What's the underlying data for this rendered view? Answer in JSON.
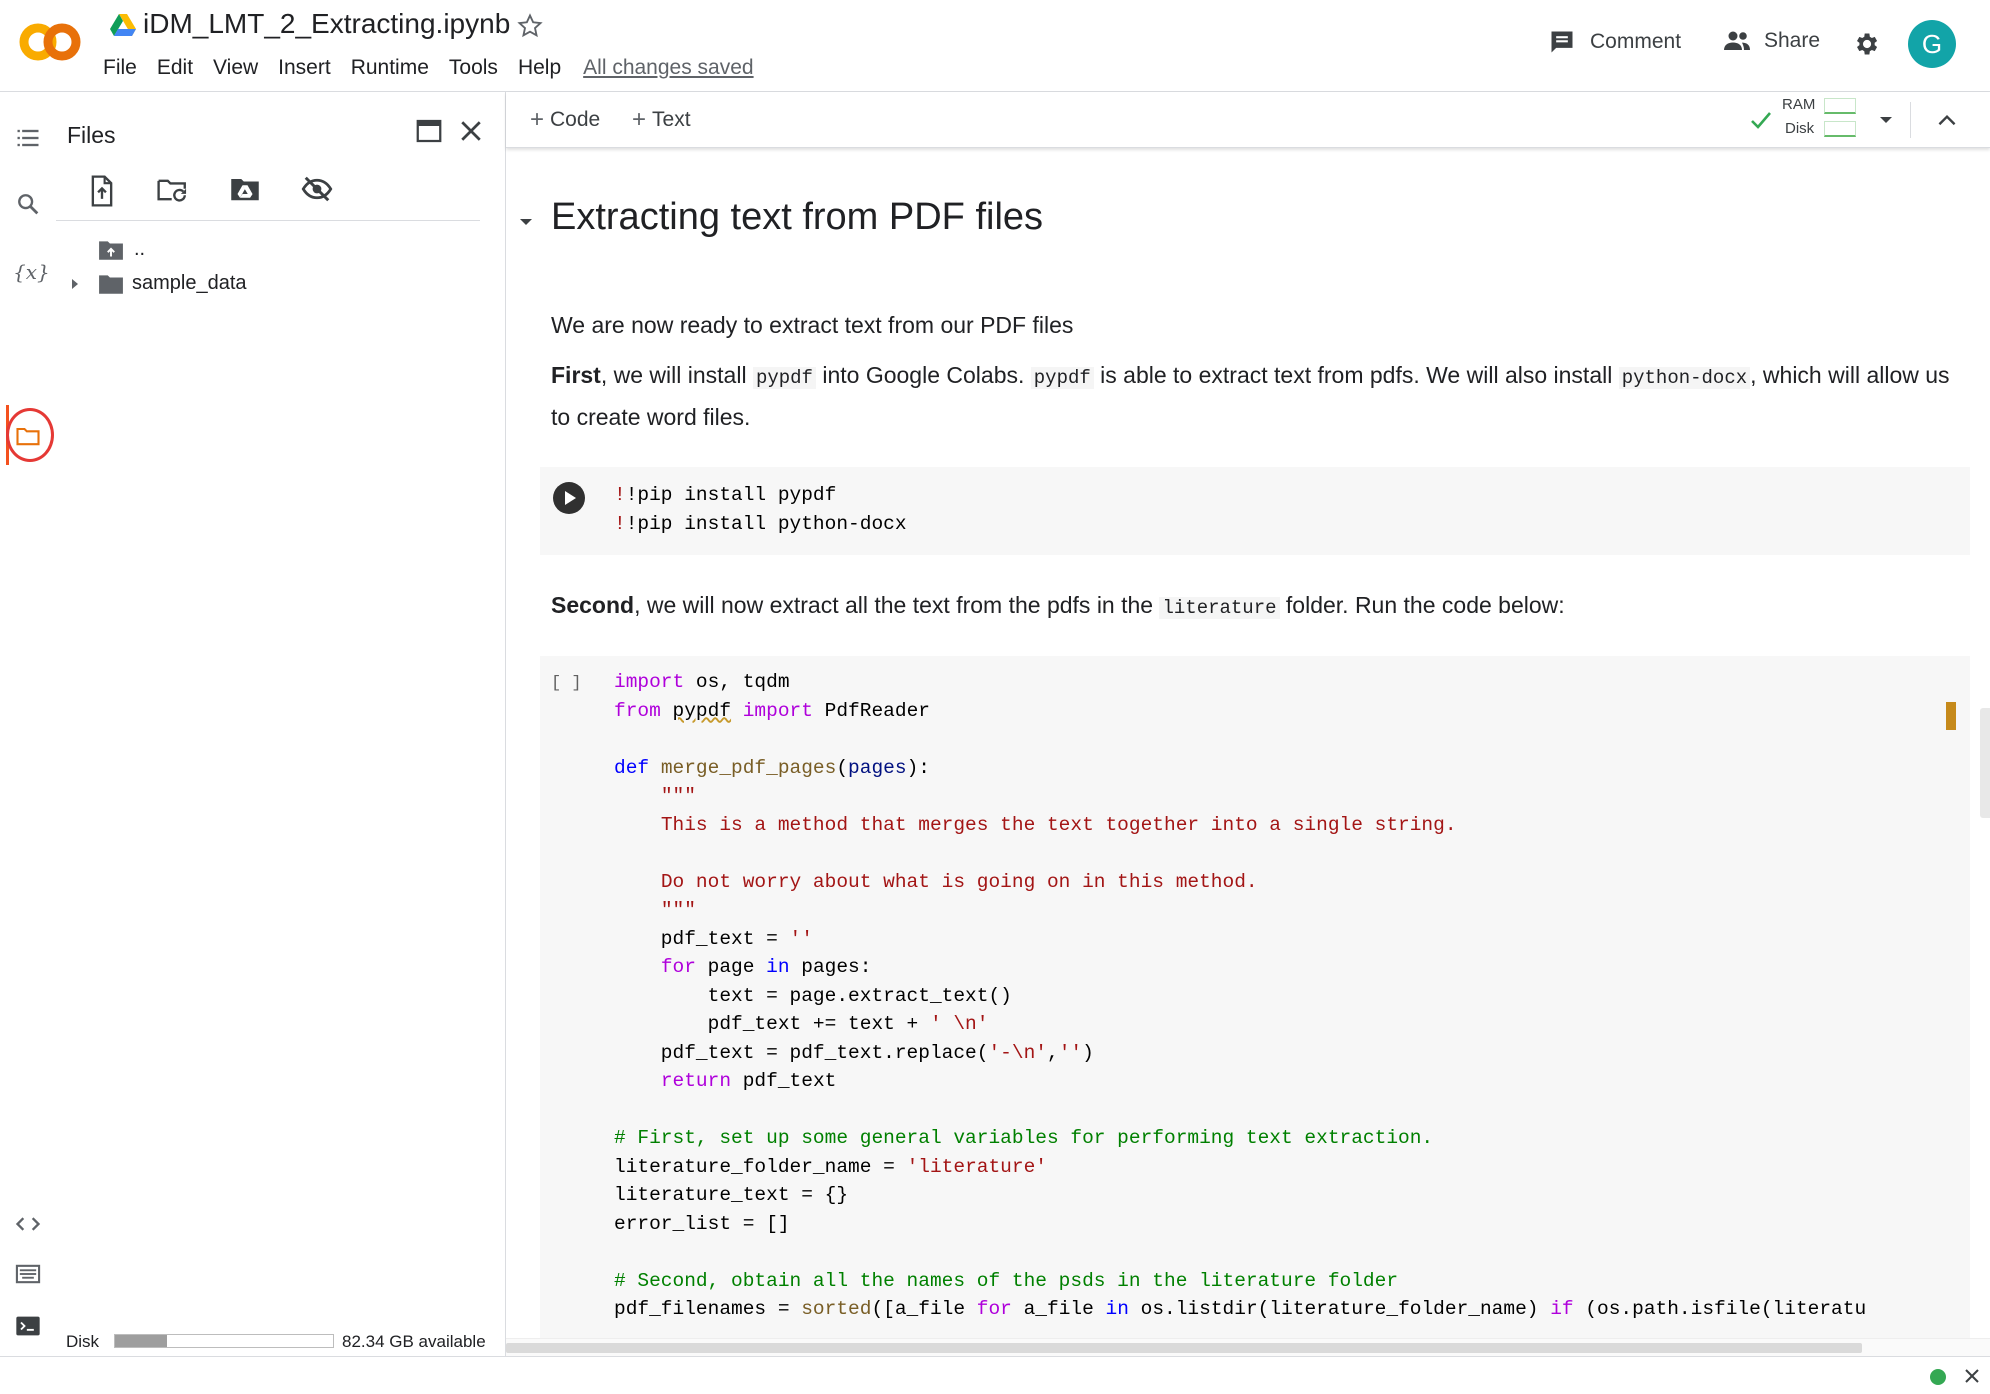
{
  "header": {
    "logo_text": "CO",
    "doc_title": "iDM_LMT_2_Extracting.ipynb",
    "menus": [
      "File",
      "Edit",
      "View",
      "Insert",
      "Runtime",
      "Tools",
      "Help"
    ],
    "save_status": "All changes saved",
    "comment_label": "Comment",
    "share_label": "Share",
    "avatar_letter": "G"
  },
  "files_panel": {
    "title": "Files",
    "tree": [
      {
        "label": "..",
        "kind": "parent-folder"
      },
      {
        "label": "sample_data",
        "kind": "folder"
      }
    ],
    "disk_label": "Disk",
    "disk_available": "82.34 GB available",
    "disk_used_fraction": 0.24
  },
  "toolbar": {
    "add_code_label": "Code",
    "add_text_label": "Text",
    "ram_label": "RAM",
    "disk_label": "Disk"
  },
  "notebook": {
    "section_heading": "Extracting text from PDF files",
    "intro": "We are now ready to extract text from our PDF files",
    "first_para": {
      "bold": "First",
      "t1": ", we will install ",
      "c1": "pypdf",
      "t2": " into Google Colabs. ",
      "c2": "pypdf",
      "t3": " is able to extract text from pdfs. We will also install ",
      "c3": "python-docx",
      "t4": ", which will allow us to create word files."
    },
    "cell1_lines": [
      "!pip install pypdf",
      "!pip install python-docx"
    ],
    "second_para": {
      "bold": "Second",
      "t1": ", we will now extract all the text from the pdfs in the ",
      "c1": "literature",
      "t2": " folder. Run the code below:"
    },
    "cell2_exec": "[ ]"
  },
  "colors": {
    "keyword": "#af00db",
    "def_keyword": "#0000ff",
    "function": "#795e26",
    "string": "#a31515",
    "comment": "#008000",
    "avatar": "#12a4a8",
    "status_ok": "#34a853"
  }
}
